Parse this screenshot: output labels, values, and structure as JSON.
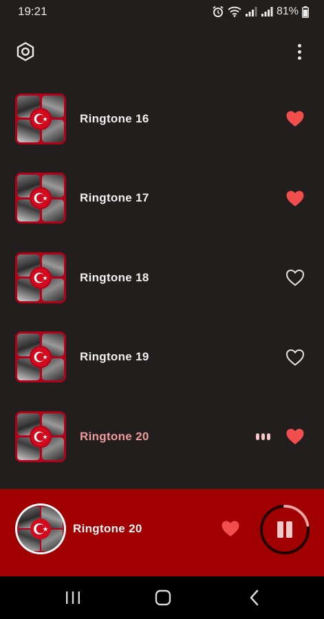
{
  "status_bar": {
    "time": "19:21",
    "battery_percent": "81%",
    "icons": [
      "alarm-icon",
      "wifi-icon",
      "signal-icon",
      "signal-icon",
      "battery-icon"
    ]
  },
  "top_bar": {
    "settings_icon": "settings-icon",
    "menu_icon": "more-vert-icon"
  },
  "ringtones": [
    {
      "title": "Ringtone 16",
      "favorite": true,
      "playing": false
    },
    {
      "title": "Ringtone 17",
      "favorite": true,
      "playing": false
    },
    {
      "title": "Ringtone 18",
      "favorite": false,
      "playing": false
    },
    {
      "title": "Ringtone 19",
      "favorite": false,
      "playing": false
    },
    {
      "title": "Ringtone 20",
      "favorite": true,
      "playing": true
    }
  ],
  "player": {
    "title": "Ringtone 20",
    "favorite": true,
    "progress_fraction": 0.22,
    "state_icon": "pause-icon"
  },
  "colors": {
    "background": "#211e1d",
    "player_bar": "#a10000",
    "heart_filled": "#f24e4e",
    "active_title": "#ef9b9c",
    "progress_ring": "#f1a3a3"
  },
  "nav_bar": {
    "icons": [
      "recent-apps-icon",
      "home-icon",
      "back-icon"
    ]
  }
}
